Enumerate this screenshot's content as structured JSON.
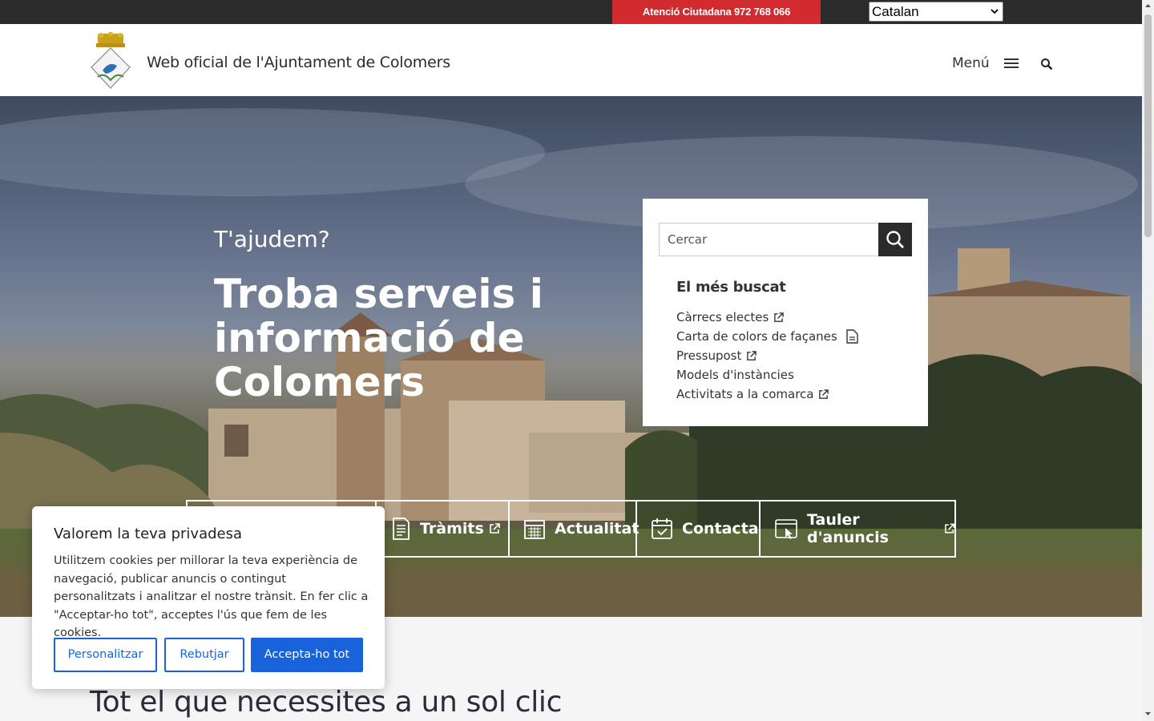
{
  "topbar": {
    "attention": "Atenció Ciutadana 972 768 066",
    "language": "Catalan"
  },
  "header": {
    "title": "Web oficial de l'Ajuntament de Colomers",
    "menu_label": "Menú"
  },
  "hero": {
    "kicker": "T'ajudem?",
    "title": "Troba serveis i informació de Colomers"
  },
  "search_panel": {
    "placeholder": "Cercar",
    "heading": "El més buscat",
    "links": [
      {
        "label": "Càrrecs electes",
        "icon": "external-link-icon"
      },
      {
        "label": "Carta de colors de façanes",
        "icon": "document-icon"
      },
      {
        "label": "Pressupost",
        "icon": "external-link-icon"
      },
      {
        "label": "Models d'instàncies",
        "icon": ""
      },
      {
        "label": "Activitats a la comarca",
        "icon": "external-link-icon"
      }
    ]
  },
  "quick_links": [
    {
      "label": "Tràmits",
      "icon": "document-list-icon",
      "external": true
    },
    {
      "label": "Actualitat",
      "icon": "calendar-grid-icon",
      "external": false
    },
    {
      "label": "Contacta",
      "icon": "calendar-check-icon",
      "external": false
    },
    {
      "label": "Tauler d'anuncis",
      "icon": "board-cursor-icon",
      "external": true
    }
  ],
  "section": {
    "title": "Tot el que necessites a un sol clic"
  },
  "cookie": {
    "title": "Valorem la teva privadesa",
    "text": "Utilitzem cookies per millorar la teva experiència de navegació, publicar anuncis o contingut personalitzats i analitzar el nostre trànsit. En fer clic a \"Acceptar-ho tot\", acceptes l'ús que fem de les cookies.",
    "customize": "Personalitzar",
    "reject": "Rebutjar",
    "accept": "Accepta-ho tot"
  },
  "colors": {
    "topbar": "#2b2b2b",
    "attention": "#d12b2f",
    "accent_blue": "#1863dc"
  }
}
